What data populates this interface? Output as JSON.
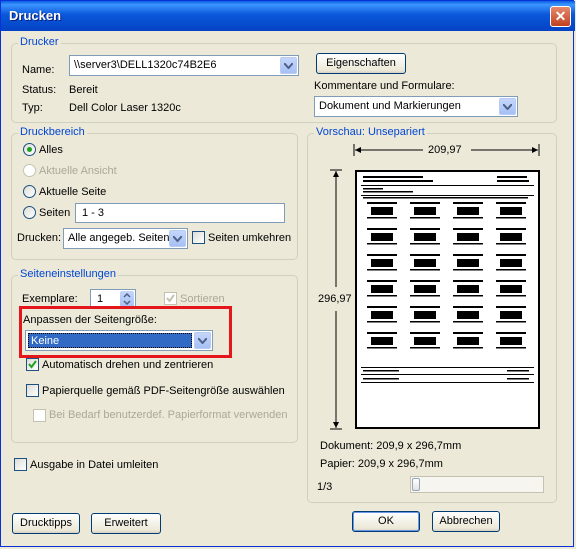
{
  "window": {
    "title": "Drucken"
  },
  "printer": {
    "group_title": "Drucker",
    "name_label": "Name:",
    "name_value": "\\\\server3\\DELL1320c74B2E6",
    "status_label": "Status:",
    "status_value": "Bereit",
    "type_label": "Typ:",
    "type_value": "Dell Color Laser 1320c",
    "properties_button": "Eigenschaften",
    "comments_label": "Kommentare und Formulare:",
    "comments_value": "Dokument und Markierungen"
  },
  "range": {
    "group_title": "Druckbereich",
    "all_label": "Alles",
    "current_view_label": "Aktuelle Ansicht",
    "current_page_label": "Aktuelle Seite",
    "pages_label": "Seiten",
    "pages_value": "1 - 3",
    "print_label": "Drucken:",
    "print_value": "Alle angegeb. Seiten",
    "reverse_label": "Seiten umkehren"
  },
  "page_setup": {
    "group_title": "Seiteneinstellungen",
    "copies_label": "Exemplare:",
    "copies_value": "1",
    "collate_label": "Sortieren",
    "scaling_label": "Anpassen der Seitengröße:",
    "scaling_value": "Keine",
    "auto_rotate_label": "Automatisch drehen und zentrieren",
    "paper_source_label": "Papierquelle gemäß PDF-Seitengröße auswählen",
    "custom_paper_label": "Bei Bedarf benutzerdef. Papierformat verwenden"
  },
  "print_to_file_label": "Ausgabe in Datei umleiten",
  "preview": {
    "group_title": "Vorschau: Unsepariert",
    "width_dim": "209,97",
    "height_dim": "296,97",
    "document_label": "Dokument: 209,9 x 296,7mm",
    "paper_label": "Papier: 209,9 x 296,7mm",
    "page_counter": "1/3",
    "slider_position": 0
  },
  "buttons": {
    "tips": "Drucktipps",
    "advanced": "Erweitert",
    "ok": "OK",
    "cancel": "Abbrechen"
  },
  "colors": {
    "titlebar": "#0a58db",
    "group_title": "#0046d5",
    "highlight": "#0a246a",
    "annotation_box": "#e3161c"
  }
}
